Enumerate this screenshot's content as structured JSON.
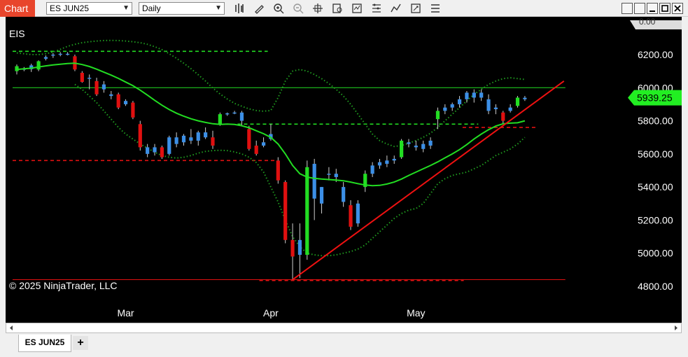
{
  "window": {
    "app_title": "Chart",
    "instrument": "ES JUN25",
    "interval": "Daily"
  },
  "tabs": [
    {
      "label": "ES JUN25",
      "active": true
    }
  ],
  "add_tab_label": "+",
  "chart": {
    "indicator_label": "EIS",
    "copyright": "© 2025 NinjaTrader, LLC",
    "last_price_label": "5939.25",
    "top_cut_label": "0.00",
    "colors": {
      "background": "#000000",
      "up": "#22dd22",
      "down": "#e01010",
      "neutral": "#3c8fe6",
      "ma": "#22dd22",
      "band": "#1f9a1f",
      "trend": "#ee1111",
      "price_badge": "#22ee22"
    }
  },
  "chart_data": {
    "type": "candlestick",
    "y_ticks": [
      "6200.00",
      "6000.00",
      "5800.00",
      "5600.00",
      "5400.00",
      "5200.00",
      "5000.00",
      "4800.00"
    ],
    "ylim": [
      4760,
      6300
    ],
    "x_ticks": [
      {
        "label": "Mar",
        "index": 15
      },
      {
        "label": "Apr",
        "index": 35
      },
      {
        "label": "May",
        "index": 55
      }
    ],
    "candles": [
      {
        "o": 6100,
        "h": 6140,
        "l": 6080,
        "c": 6130,
        "s": "up"
      },
      {
        "o": 6115,
        "h": 6125,
        "l": 6100,
        "c": 6112,
        "s": "neutral"
      },
      {
        "o": 6112,
        "h": 6145,
        "l": 6095,
        "c": 6135,
        "s": "neutral"
      },
      {
        "o": 6110,
        "h": 6165,
        "l": 6100,
        "c": 6160,
        "s": "up"
      },
      {
        "o": 6175,
        "h": 6195,
        "l": 6165,
        "c": 6185,
        "s": "neutral"
      },
      {
        "o": 6195,
        "h": 6210,
        "l": 6180,
        "c": 6200,
        "s": "neutral"
      },
      {
        "o": 6200,
        "h": 6215,
        "l": 6190,
        "c": 6205,
        "s": "neutral"
      },
      {
        "o": 6205,
        "h": 6215,
        "l": 6195,
        "c": 6200,
        "s": "neutral"
      },
      {
        "o": 6190,
        "h": 6200,
        "l": 6100,
        "c": 6110,
        "s": "down"
      },
      {
        "o": 6090,
        "h": 6100,
        "l": 6030,
        "c": 6035,
        "s": "down"
      },
      {
        "o": 6060,
        "h": 6080,
        "l": 5990,
        "c": 6060,
        "s": "neutral"
      },
      {
        "o": 6040,
        "h": 6060,
        "l": 5950,
        "c": 5960,
        "s": "down"
      },
      {
        "o": 5990,
        "h": 6040,
        "l": 5970,
        "c": 6020,
        "s": "neutral"
      },
      {
        "o": 5960,
        "h": 5980,
        "l": 5930,
        "c": 5950,
        "s": "neutral"
      },
      {
        "o": 5960,
        "h": 5970,
        "l": 5870,
        "c": 5880,
        "s": "down"
      },
      {
        "o": 5920,
        "h": 5930,
        "l": 5890,
        "c": 5900,
        "s": "neutral"
      },
      {
        "o": 5910,
        "h": 5920,
        "l": 5810,
        "c": 5820,
        "s": "down"
      },
      {
        "o": 5780,
        "h": 5800,
        "l": 5620,
        "c": 5640,
        "s": "down"
      },
      {
        "o": 5640,
        "h": 5660,
        "l": 5580,
        "c": 5600,
        "s": "neutral"
      },
      {
        "o": 5640,
        "h": 5660,
        "l": 5590,
        "c": 5610,
        "s": "neutral"
      },
      {
        "o": 5640,
        "h": 5650,
        "l": 5570,
        "c": 5580,
        "s": "down"
      },
      {
        "o": 5600,
        "h": 5710,
        "l": 5590,
        "c": 5700,
        "s": "neutral"
      },
      {
        "o": 5700,
        "h": 5730,
        "l": 5640,
        "c": 5660,
        "s": "neutral"
      },
      {
        "o": 5670,
        "h": 5720,
        "l": 5650,
        "c": 5710,
        "s": "neutral"
      },
      {
        "o": 5700,
        "h": 5750,
        "l": 5660,
        "c": 5680,
        "s": "neutral"
      },
      {
        "o": 5680,
        "h": 5740,
        "l": 5650,
        "c": 5730,
        "s": "neutral"
      },
      {
        "o": 5730,
        "h": 5760,
        "l": 5690,
        "c": 5700,
        "s": "neutral"
      },
      {
        "o": 5700,
        "h": 5740,
        "l": 5630,
        "c": 5650,
        "s": "down"
      },
      {
        "o": 5780,
        "h": 5850,
        "l": 5770,
        "c": 5840,
        "s": "up"
      },
      {
        "o": 5840,
        "h": 5850,
        "l": 5830,
        "c": 5845,
        "s": "neutral"
      },
      {
        "o": 5850,
        "h": 5860,
        "l": 5840,
        "c": 5850,
        "s": "neutral"
      },
      {
        "o": 5800,
        "h": 5860,
        "l": 5770,
        "c": 5850,
        "s": "neutral"
      },
      {
        "o": 5750,
        "h": 5770,
        "l": 5620,
        "c": 5630,
        "s": "down"
      },
      {
        "o": 5650,
        "h": 5680,
        "l": 5590,
        "c": 5600,
        "s": "down"
      },
      {
        "o": 5670,
        "h": 5700,
        "l": 5640,
        "c": 5650,
        "s": "neutral"
      },
      {
        "o": 5720,
        "h": 5780,
        "l": 5680,
        "c": 5690,
        "s": "neutral"
      },
      {
        "o": 5560,
        "h": 5580,
        "l": 5420,
        "c": 5440,
        "s": "down"
      },
      {
        "o": 5430,
        "h": 5440,
        "l": 5060,
        "c": 5080,
        "s": "down"
      },
      {
        "o": 5080,
        "h": 5180,
        "l": 4840,
        "c": 4980,
        "s": "down"
      },
      {
        "o": 4990,
        "h": 5180,
        "l": 4850,
        "c": 5080,
        "s": "neutral"
      },
      {
        "o": 4990,
        "h": 5560,
        "l": 4960,
        "c": 5520,
        "s": "up"
      },
      {
        "o": 5540,
        "h": 5570,
        "l": 5200,
        "c": 5330,
        "s": "neutral"
      },
      {
        "o": 5300,
        "h": 5400,
        "l": 5240,
        "c": 5400,
        "s": "neutral"
      },
      {
        "o": 5480,
        "h": 5520,
        "l": 5440,
        "c": 5480,
        "s": "neutral"
      },
      {
        "o": 5480,
        "h": 5510,
        "l": 5430,
        "c": 5460,
        "s": "neutral"
      },
      {
        "o": 5400,
        "h": 5430,
        "l": 5280,
        "c": 5310,
        "s": "neutral"
      },
      {
        "o": 5290,
        "h": 5320,
        "l": 5140,
        "c": 5160,
        "s": "down"
      },
      {
        "o": 5180,
        "h": 5320,
        "l": 5160,
        "c": 5300,
        "s": "neutral"
      },
      {
        "o": 5400,
        "h": 5500,
        "l": 5370,
        "c": 5480,
        "s": "up"
      },
      {
        "o": 5480,
        "h": 5550,
        "l": 5460,
        "c": 5530,
        "s": "neutral"
      },
      {
        "o": 5530,
        "h": 5570,
        "l": 5510,
        "c": 5550,
        "s": "neutral"
      },
      {
        "o": 5540,
        "h": 5590,
        "l": 5520,
        "c": 5560,
        "s": "neutral"
      },
      {
        "o": 5560,
        "h": 5590,
        "l": 5540,
        "c": 5570,
        "s": "neutral"
      },
      {
        "o": 5580,
        "h": 5690,
        "l": 5570,
        "c": 5680,
        "s": "up"
      },
      {
        "o": 5660,
        "h": 5690,
        "l": 5640,
        "c": 5670,
        "s": "neutral"
      },
      {
        "o": 5640,
        "h": 5680,
        "l": 5620,
        "c": 5650,
        "s": "neutral"
      },
      {
        "o": 5630,
        "h": 5680,
        "l": 5610,
        "c": 5660,
        "s": "neutral"
      },
      {
        "o": 5650,
        "h": 5700,
        "l": 5630,
        "c": 5680,
        "s": "neutral"
      },
      {
        "o": 5810,
        "h": 5880,
        "l": 5750,
        "c": 5860,
        "s": "up"
      },
      {
        "o": 5860,
        "h": 5900,
        "l": 5840,
        "c": 5880,
        "s": "neutral"
      },
      {
        "o": 5880,
        "h": 5910,
        "l": 5860,
        "c": 5900,
        "s": "neutral"
      },
      {
        "o": 5900,
        "h": 5950,
        "l": 5880,
        "c": 5930,
        "s": "neutral"
      },
      {
        "o": 5930,
        "h": 5980,
        "l": 5910,
        "c": 5970,
        "s": "neutral"
      },
      {
        "o": 5940,
        "h": 5990,
        "l": 5910,
        "c": 5970,
        "s": "neutral"
      },
      {
        "o": 5940,
        "h": 5990,
        "l": 5920,
        "c": 5970,
        "s": "neutral"
      },
      {
        "o": 5930,
        "h": 5960,
        "l": 5840,
        "c": 5860,
        "s": "neutral"
      },
      {
        "o": 5870,
        "h": 5900,
        "l": 5840,
        "c": 5880,
        "s": "neutral"
      },
      {
        "o": 5850,
        "h": 5860,
        "l": 5780,
        "c": 5800,
        "s": "down"
      },
      {
        "o": 5860,
        "h": 5900,
        "l": 5850,
        "c": 5880,
        "s": "neutral"
      },
      {
        "o": 5890,
        "h": 5950,
        "l": 5880,
        "c": 5940,
        "s": "up"
      },
      {
        "o": 5930,
        "h": 5950,
        "l": 5920,
        "c": 5939.25,
        "s": "neutral"
      }
    ],
    "moving_average": [
      6110,
      6114,
      6118,
      6125,
      6132,
      6138,
      6142,
      6146,
      6148,
      6140,
      6128,
      6112,
      6094,
      6076,
      6056,
      6034,
      6012,
      5985,
      5955,
      5924,
      5894,
      5868,
      5846,
      5828,
      5812,
      5800,
      5790,
      5782,
      5778,
      5780,
      5778,
      5770,
      5758,
      5740,
      5722,
      5700,
      5660,
      5600,
      5530,
      5480,
      5460,
      5452,
      5448,
      5445,
      5442,
      5438,
      5430,
      5420,
      5412,
      5408,
      5410,
      5418,
      5430,
      5448,
      5470,
      5490,
      5510,
      5530,
      5552,
      5576,
      5600,
      5626,
      5656,
      5690,
      5720,
      5746,
      5768,
      5782,
      5786,
      5788,
      5800
    ],
    "upper_band": [
      6210,
      6205,
      6200,
      6200,
      6205,
      6215,
      6232,
      6250,
      6262,
      6272,
      6278,
      6282,
      6285,
      6286,
      6285,
      6282,
      6278,
      6272,
      6262,
      6248,
      6230,
      6205,
      6178,
      6148,
      6115,
      6078,
      6040,
      5998,
      5962,
      5932,
      5905,
      5888,
      5872,
      5862,
      5858,
      5862,
      5940,
      6040,
      6100,
      6110,
      6100,
      6080,
      6055,
      6025,
      5990,
      5950,
      5900,
      5840,
      5780,
      5720,
      5680,
      5660,
      5645,
      5650,
      5665,
      5680,
      5700,
      5725,
      5760,
      5800,
      5840,
      5880,
      5920,
      5960,
      5990,
      6020,
      6040,
      6055,
      6060,
      6055,
      6050
    ],
    "lower_band": [
      null,
      null,
      null,
      null,
      null,
      null,
      null,
      null,
      6020,
      5990,
      5950,
      5910,
      5860,
      5810,
      5760,
      5720,
      5690,
      5660,
      5635,
      5610,
      5590,
      5580,
      5575,
      5580,
      5590,
      5605,
      5615,
      5620,
      5622,
      5620,
      5612,
      5600,
      5580,
      5548,
      5490,
      5400,
      5310,
      5200,
      5100,
      5040,
      5000,
      4990,
      4985,
      4985,
      4990,
      5000,
      5010,
      5025,
      5050,
      5090,
      5130,
      5170,
      5210,
      5240,
      5260,
      5270,
      5300,
      5360,
      5420,
      5450,
      5470,
      5480,
      5490,
      5510,
      5530,
      5560,
      5590,
      5610,
      5630,
      5660,
      5700
    ],
    "horizontal_levels": [
      {
        "value": 6220,
        "style": "dashed",
        "color": "#22dd22",
        "from": 0,
        "to": 34
      },
      {
        "value": 6000,
        "style": "solid",
        "color": "#22dd22",
        "from": 0,
        "to": 75
      },
      {
        "value": 5780,
        "style": "dashed",
        "color": "#22dd22",
        "from": 31,
        "to": 63
      },
      {
        "value": 5760,
        "style": "dashed",
        "color": "#e01010",
        "from": 62,
        "to": 71
      },
      {
        "value": 5560,
        "style": "dashed",
        "color": "#e01010",
        "from": 0,
        "to": 35
      },
      {
        "value": 4840,
        "style": "solid",
        "color": "#e01010",
        "from": 0,
        "to": 75
      },
      {
        "value": 4835,
        "style": "dashed",
        "color": "#e01010",
        "from": 34,
        "to": 61
      }
    ],
    "trendline": {
      "from": {
        "index": 38,
        "value": 4840
      },
      "to": {
        "index": 75,
        "value": 6040
      }
    }
  }
}
